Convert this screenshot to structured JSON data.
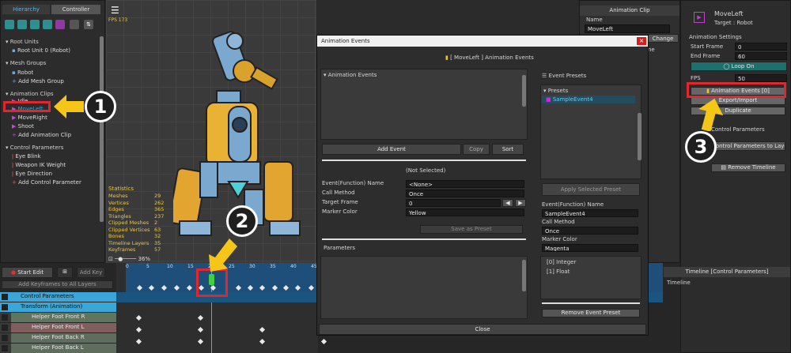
{
  "hierarchy": {
    "tabs": [
      "Hierarchy",
      "Controller"
    ],
    "groups": [
      {
        "title": "Root Units",
        "items": [
          "Root Unit 0 (Robot)"
        ]
      },
      {
        "title": "Mesh Groups",
        "items": [
          "Robot",
          "Add Mesh Group"
        ]
      },
      {
        "title": "Animation Clips",
        "items": [
          "Idle",
          "MoveLeft",
          "MoveRight",
          "Shoot",
          "Add Animation Clip"
        ]
      },
      {
        "title": "Control Parameters",
        "items": [
          "Eye Blink",
          "Weapon IK Weight",
          "Eye Direction",
          "Add Control Parameter"
        ]
      }
    ]
  },
  "viewport": {
    "fps": "FPS 173",
    "zoom": "36%",
    "stats_title": "Statistics",
    "stats": [
      [
        "Meshes",
        "29"
      ],
      [
        "Vertices",
        "262"
      ],
      [
        "Edges",
        "365"
      ],
      [
        "Triangles",
        "237"
      ],
      [
        "Clipped Meshes",
        "2"
      ],
      [
        "Clipped Vertices",
        "63"
      ],
      [
        "Bones",
        "32"
      ],
      [
        "Timeline Layers",
        "35"
      ],
      [
        "Keyframes",
        "57"
      ]
    ]
  },
  "timeline": {
    "start_edit": "Start Edit",
    "add_key": "Add Key",
    "add_keyframes": "Add Keyframes to All Layers",
    "ticks": [
      "0",
      "5",
      "10",
      "15",
      "20",
      "25",
      "30",
      "35",
      "40",
      "45"
    ],
    "layers": [
      {
        "name": "Control Parameters",
        "color": "#3aa7d8"
      },
      {
        "name": "Transform (Animation)",
        "color": "#3aa7d8"
      },
      {
        "name": "Helper Foot Front R",
        "color": "#6d8a6d"
      },
      {
        "name": "Helper Foot Front L",
        "color": "#9a6b6b"
      },
      {
        "name": "Helper Foot Back R",
        "color": "#6b7f6b"
      },
      {
        "name": "Helper Foot Back L",
        "color": "#6b7f6b"
      }
    ]
  },
  "dialog": {
    "title": "Animation Events",
    "heading": "[ MoveLeft ] Animation Events",
    "events_label": "Animation Events",
    "add_event": "Add Event",
    "copy": "Copy",
    "sort": "Sort",
    "not_selected": "(Not Selected)",
    "fields": [
      {
        "label": "Event(Function) Name",
        "value": "<None>"
      },
      {
        "label": "Call Method",
        "value": "Once"
      },
      {
        "label": "Target Frame",
        "value": "0"
      },
      {
        "label": "Marker Color",
        "value": "Yellow"
      }
    ],
    "save_preset": "Save as Preset",
    "parameters": "Parameters",
    "close": "Close",
    "presets_header": "Event Presets",
    "presets_group": "Presets",
    "preset_item": "SampleEvent4",
    "apply_preset": "Apply Selected Preset",
    "preset_fields": [
      {
        "label": "Event(Function) Name",
        "value": "SampleEvent4"
      },
      {
        "label": "Call Method",
        "value": "Once"
      },
      {
        "label": "Marker Color",
        "value": "Magenta"
      }
    ],
    "param_items": [
      "[0] Integer",
      "[1] Float"
    ],
    "remove_preset": "Remove Event Preset"
  },
  "clip_panel": {
    "header": "Animation Clip",
    "name_label": "Name",
    "name_value": "MoveLeft",
    "change": "Change",
    "duplicate_label": "ne"
  },
  "right_panel": {
    "clip_name": "MoveLeft",
    "target": "Target : Robot",
    "settings": "Animation Settings",
    "start_frame_label": "Start Frame",
    "start_frame": "0",
    "end_frame_label": "End Frame",
    "end_frame": "60",
    "loop": "Loop On",
    "fps_label": "FPS",
    "fps": "50",
    "events_btn": "Animation Events [0]",
    "export": "Export/Import",
    "duplicate": "Duplicate",
    "control_params": "Control Parameters",
    "cp_to_layers": "Control Parameters to Layers",
    "remove_timeline": "Remove Timeline",
    "timeline_header": "Timeline [Control Parameters]",
    "timeline_label": "Timeline"
  },
  "callouts": [
    "1",
    "2",
    "3"
  ],
  "colors": {
    "accent": "#3aa7d8",
    "red": "#e0262f",
    "yellow": "#f5c518",
    "magenta": "#e020e0",
    "loop": "#1f6f6f"
  }
}
